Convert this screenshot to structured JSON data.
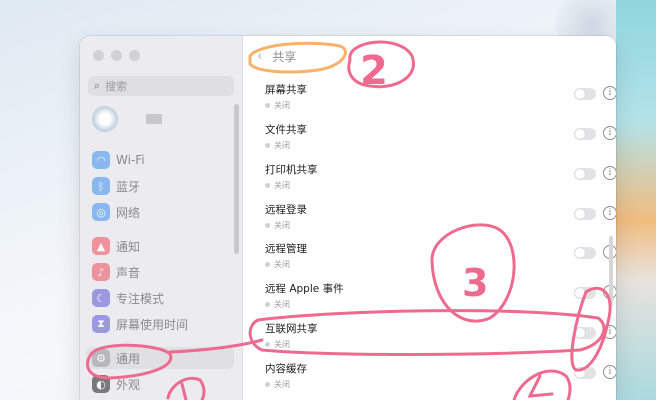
{
  "sidebar": {
    "search_placeholder": "搜索",
    "items": [
      {
        "label": "Wi-Fi",
        "icon": "wifi-icon",
        "color": "#3a8ff0"
      },
      {
        "label": "蓝牙",
        "icon": "bluetooth-icon",
        "color": "#3a8ff0"
      },
      {
        "label": "网络",
        "icon": "globe-icon",
        "color": "#3a8ff0"
      },
      {
        "label": "通知",
        "icon": "bell-icon",
        "color": "#f04a58"
      },
      {
        "label": "声音",
        "icon": "speaker-icon",
        "color": "#f04a58"
      },
      {
        "label": "专注模式",
        "icon": "moon-icon",
        "color": "#5a56d6"
      },
      {
        "label": "屏幕使用时间",
        "icon": "hourglass-icon",
        "color": "#5a56d6"
      },
      {
        "label": "通用",
        "icon": "gear-icon",
        "color": "#8e8e93"
      },
      {
        "label": "外观",
        "icon": "appearance-icon",
        "color": "#1d1d1f"
      }
    ]
  },
  "main": {
    "title": "共享",
    "rows": [
      {
        "name": "屏幕共享",
        "status": "关闭"
      },
      {
        "name": "文件共享",
        "status": "关闭"
      },
      {
        "name": "打印机共享",
        "status": "关闭"
      },
      {
        "name": "远程登录",
        "status": "关闭"
      },
      {
        "name": "远程管理",
        "status": "关闭"
      },
      {
        "name": "远程 Apple 事件",
        "status": "关闭"
      },
      {
        "name": "互联网共享",
        "status": "关闭"
      },
      {
        "name": "内容缓存",
        "status": "关闭"
      }
    ]
  },
  "annotations": {
    "pen_color": "#ee6b8f",
    "highlight_color": "#f6b26b",
    "numbers": [
      "2",
      "3"
    ]
  }
}
